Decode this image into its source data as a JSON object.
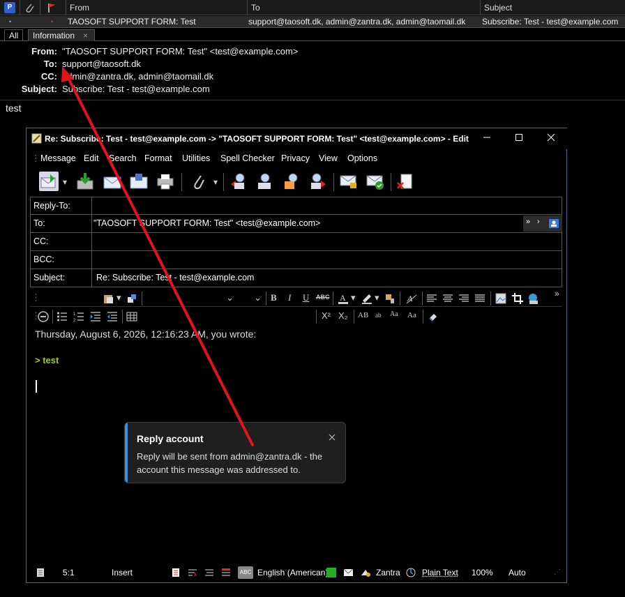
{
  "list": {
    "headers": {
      "from": "From",
      "to": "To",
      "subject": "Subject"
    },
    "row": {
      "from": "TAOSOFT SUPPORT FORM: Test",
      "to": "support@taosoft.dk, admin@zantra.dk, admin@taomail.dk",
      "subject": "Subscribe: Test - test@example.com"
    }
  },
  "tabs": {
    "all": "All",
    "information": "Information",
    "close_glyph": "×"
  },
  "message": {
    "from_label": "From:",
    "from": "\"TAOSOFT SUPPORT FORM: Test\" <test@example.com>",
    "to_label": "To:",
    "to": "support@taosoft.dk",
    "cc_label": "CC:",
    "cc": "admin@zantra.dk, admin@taomail.dk",
    "subject_label": "Subject:",
    "subject": "Subscribe: Test - test@example.com",
    "body": "test"
  },
  "compose": {
    "title": "Re: Subscribe: Test - test@example.com -> \"TAOSOFT SUPPORT FORM: Test\" <test@example.com> - Edit ...",
    "menu": [
      "Message",
      "Edit",
      "Search",
      "Format",
      "Utilities",
      "Spell Checker",
      "Privacy",
      "View",
      "Options"
    ],
    "fields": {
      "reply_to_label": "Reply-To:",
      "reply_to": "",
      "to_label": "To:",
      "to": "\"TAOSOFT SUPPORT FORM: Test\" <test@example.com>",
      "cc_label": "CC:",
      "cc": "",
      "bcc_label": "BCC:",
      "bcc": "",
      "subject_label": "Subject:",
      "subject": "Re: Subscribe: Test - test@example.com"
    },
    "format": {
      "bold": "B",
      "italic": "I",
      "underline": "U",
      "strike": "ABC",
      "sup": "X²",
      "sub": "X₂",
      "caps": "AB",
      "small": "ab",
      "aa1": "Aa",
      "aa2": "Aa"
    },
    "body": {
      "quote_header": "Thursday, August 6, 2026, 12:16:23 AM, you wrote:",
      "quote": "> test"
    },
    "status": {
      "position": "5:1",
      "mode": "Insert",
      "language": "English (American)",
      "account": "Zantra",
      "format": "Plain Text",
      "zoom": "100%",
      "auto": "Auto"
    }
  },
  "toast": {
    "title": "Reply account",
    "message": "Reply will be sent from admin@zantra.dk - the account this message was addressed to."
  },
  "colors": {
    "accent": "#3a8ee6",
    "arrow": "#e0141c",
    "quote": "#9acd32",
    "flag": "#e03030"
  }
}
